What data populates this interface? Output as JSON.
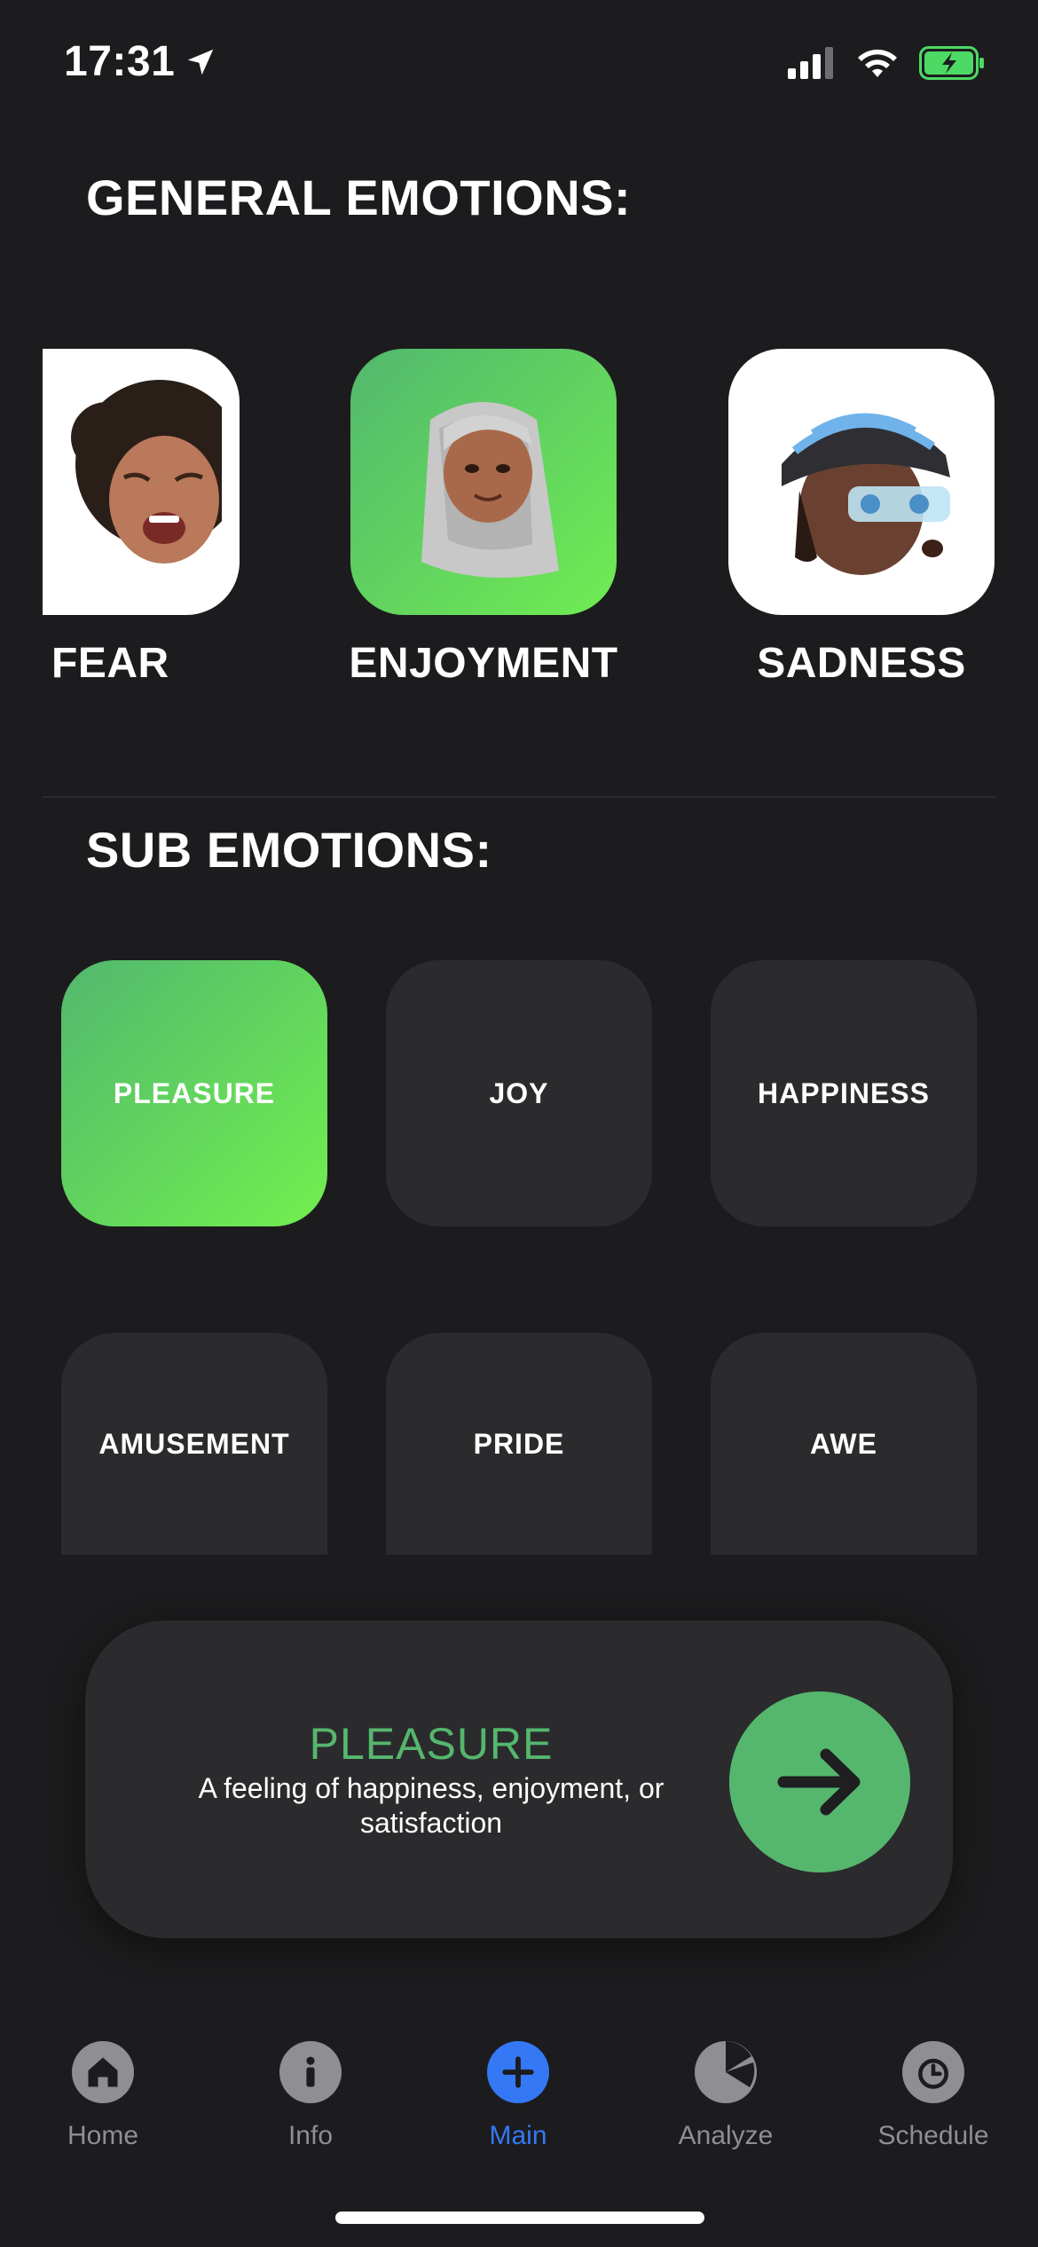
{
  "status_bar": {
    "time": "17:31"
  },
  "general": {
    "title": "GENERAL EMOTIONS:",
    "items": [
      {
        "label": "FEAR",
        "selected": false
      },
      {
        "label": "ENJOYMENT",
        "selected": true
      },
      {
        "label": "SADNESS",
        "selected": false
      }
    ]
  },
  "sub": {
    "title": "SUB EMOTIONS:",
    "items": [
      {
        "label": "PLEASURE",
        "selected": true
      },
      {
        "label": "JOY",
        "selected": false
      },
      {
        "label": "HAPPINESS",
        "selected": false
      },
      {
        "label": "AMUSEMENT",
        "selected": false
      },
      {
        "label": "PRIDE",
        "selected": false
      },
      {
        "label": "AWE",
        "selected": false
      }
    ]
  },
  "detail": {
    "title": "PLEASURE",
    "description": "A feeling of happiness, enjoyment, or satisfaction",
    "button_icon": "arrow-right-icon"
  },
  "tabbar": {
    "items": [
      {
        "label": "Home",
        "icon": "home-icon",
        "active": false
      },
      {
        "label": "Info",
        "icon": "info-icon",
        "active": false
      },
      {
        "label": "Main",
        "icon": "plus-icon",
        "active": true
      },
      {
        "label": "Analyze",
        "icon": "pie-chart-icon",
        "active": false
      },
      {
        "label": "Schedule",
        "icon": "alarm-clock-icon",
        "active": false
      }
    ]
  },
  "colors": {
    "background": "#1c1c1e",
    "accent_green": "#55b76e",
    "gradient_end": "#72ef4e",
    "tile": "#2b2b2d",
    "active_tab": "#3478f6",
    "inactive_tab": "#8e8e93"
  }
}
